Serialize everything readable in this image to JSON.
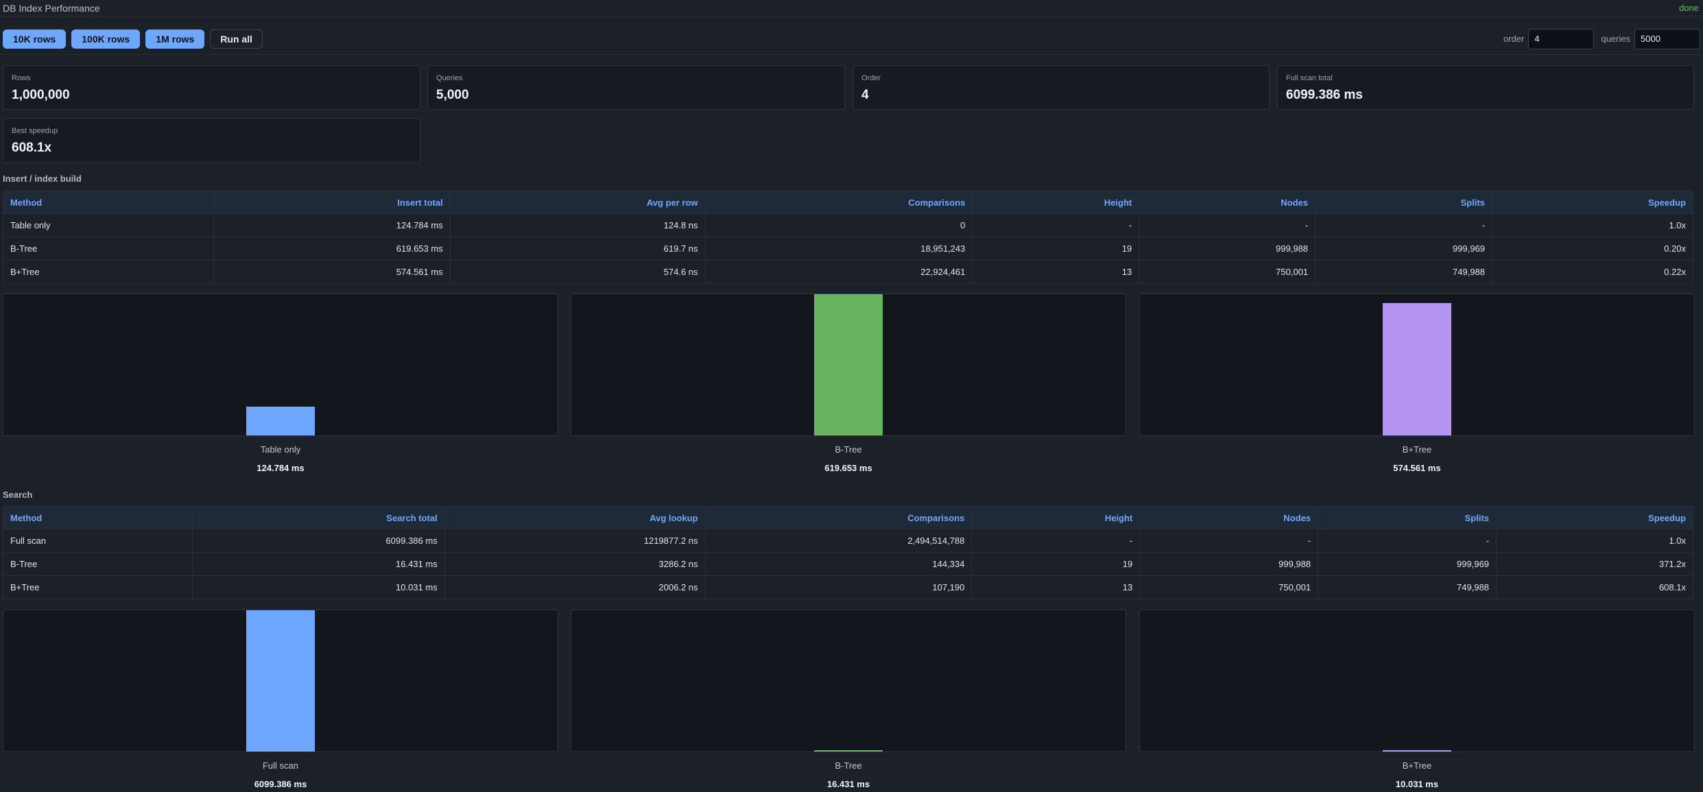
{
  "app": {
    "title": "DB Index Performance",
    "status": "done"
  },
  "toolbar": {
    "buttons": [
      "10K rows",
      "100K rows",
      "1M rows",
      "Run all"
    ],
    "order_label": "order",
    "order_value": "4",
    "queries_label": "queries",
    "queries_value": "5000"
  },
  "stats": [
    {
      "label": "Rows",
      "value": "1,000,000"
    },
    {
      "label": "Queries",
      "value": "5,000"
    },
    {
      "label": "Order",
      "value": "4"
    },
    {
      "label": "Full scan total",
      "value": "6099.386 ms"
    },
    {
      "label": "Best speedup",
      "value": "608.1x"
    }
  ],
  "insert": {
    "title": "Insert / index build",
    "headers": [
      "Method",
      "Insert total",
      "Avg per row",
      "Comparisons",
      "Height",
      "Nodes",
      "Splits",
      "Speedup"
    ],
    "rows": [
      [
        "Table only",
        "124.784 ms",
        "124.8 ns",
        "0",
        "-",
        "-",
        "-",
        "1.0x"
      ],
      [
        "B-Tree",
        "619.653 ms",
        "619.7 ns",
        "18,951,243",
        "19",
        "999,988",
        "999,969",
        "0.20x"
      ],
      [
        "B+Tree",
        "574.561 ms",
        "574.6 ns",
        "22,924,461",
        "13",
        "750,001",
        "749,988",
        "0.22x"
      ]
    ],
    "charts": [
      {
        "label": "Table only",
        "value_text": "124.784 ms",
        "value": 124.784,
        "color": "#6ea8fe"
      },
      {
        "label": "B-Tree",
        "value_text": "619.653 ms",
        "value": 619.653,
        "color": "#69b460"
      },
      {
        "label": "B+Tree",
        "value_text": "574.561 ms",
        "value": 574.561,
        "color": "#b595f2"
      }
    ]
  },
  "search": {
    "title": "Search",
    "headers": [
      "Method",
      "Search total",
      "Avg lookup",
      "Comparisons",
      "Height",
      "Nodes",
      "Splits",
      "Speedup"
    ],
    "rows": [
      [
        "Full scan",
        "6099.386 ms",
        "1219877.2 ns",
        "2,494,514,788",
        "-",
        "-",
        "-",
        "1.0x"
      ],
      [
        "B-Tree",
        "16.431 ms",
        "3286.2 ns",
        "144,334",
        "19",
        "999,988",
        "999,969",
        "371.2x"
      ],
      [
        "B+Tree",
        "10.031 ms",
        "2006.2 ns",
        "107,190",
        "13",
        "750,001",
        "749,988",
        "608.1x"
      ]
    ],
    "charts": [
      {
        "label": "Full scan",
        "value_text": "6099.386 ms",
        "value": 6099.386,
        "color": "#6ea8fe"
      },
      {
        "label": "B-Tree",
        "value_text": "16.431 ms",
        "value": 16.431,
        "color": "#69b460"
      },
      {
        "label": "B+Tree",
        "value_text": "10.031 ms",
        "value": 10.031,
        "color": "#b595f2"
      }
    ]
  },
  "chart_data": [
    {
      "type": "bar",
      "categories": [
        "Table only",
        "B-Tree",
        "B+Tree"
      ],
      "values": [
        124.784,
        619.653,
        574.561
      ],
      "data_labels": [
        "124.784 ms",
        "619.653 ms",
        "574.561 ms"
      ]
    },
    {
      "type": "bar",
      "categories": [
        "Full scan",
        "B-Tree",
        "B+Tree"
      ],
      "values": [
        6099.386,
        16.431,
        10.031
      ],
      "data_labels": [
        "6099.386 ms",
        "16.431 ms",
        "10.031 ms"
      ]
    }
  ]
}
